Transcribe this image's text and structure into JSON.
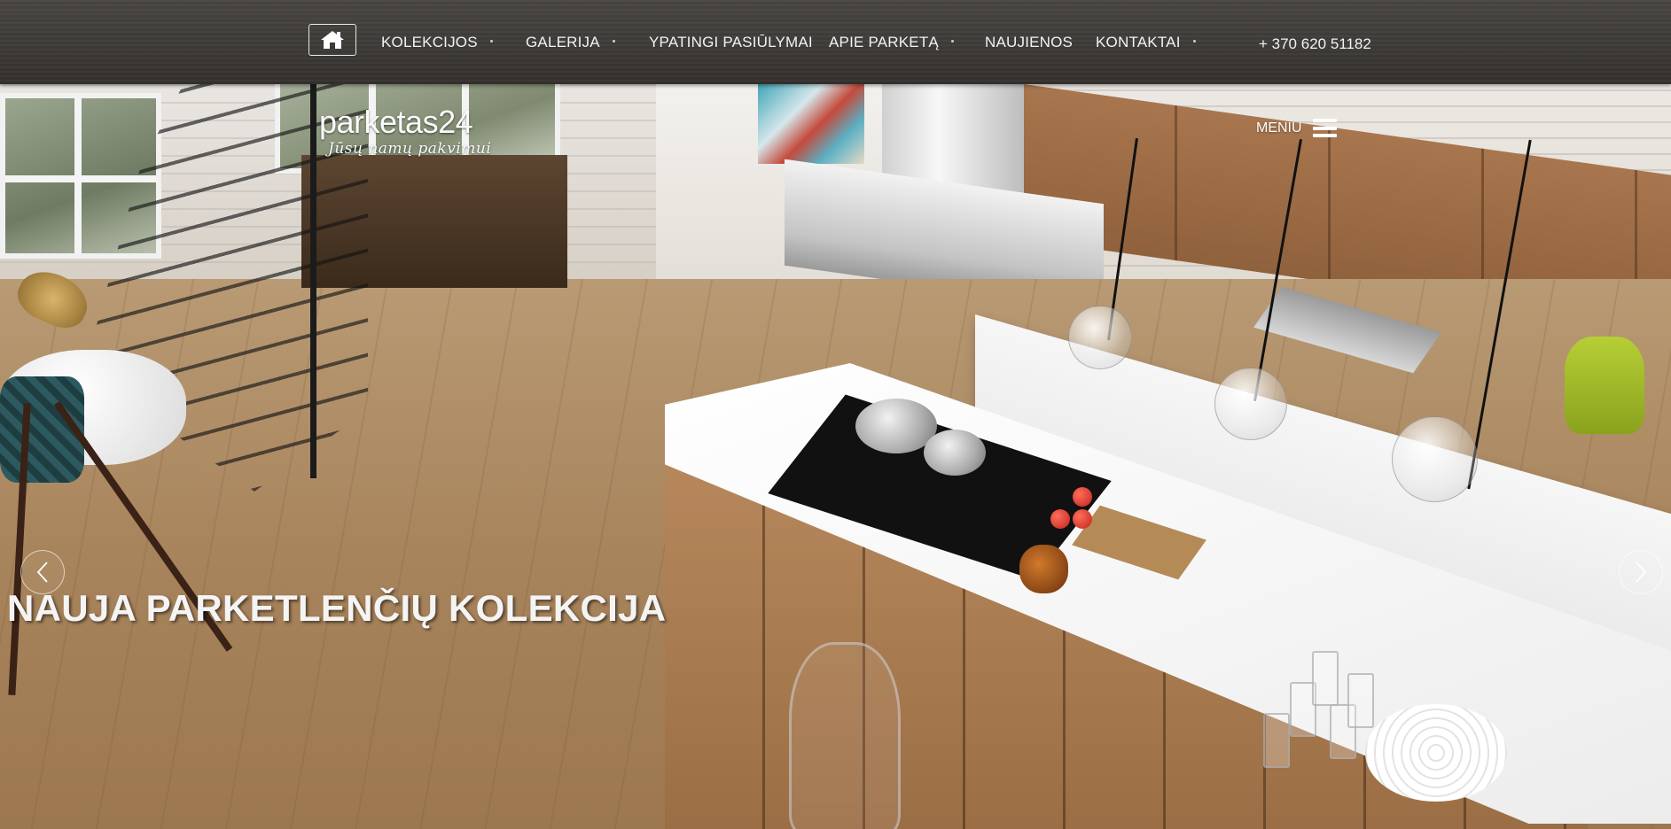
{
  "nav": {
    "home_icon": "home-icon",
    "items": [
      {
        "label": "KOLEKCIJOS",
        "has_dropdown": true
      },
      {
        "label": "GALERIJA",
        "has_dropdown": true
      },
      {
        "label": "YPATINGI PASIŪLYMAI",
        "has_dropdown": false
      },
      {
        "label": "APIE PARKETĄ",
        "has_dropdown": true
      },
      {
        "label": "NAUJIENOS",
        "has_dropdown": false
      },
      {
        "label": "KONTAKTAI",
        "has_dropdown": true
      }
    ],
    "phone": "+ 370 620 51182"
  },
  "logo": {
    "name": "parketas24",
    "tagline": "Jūsų namų pakvimui"
  },
  "menu_toggle": {
    "label": "MENIU",
    "icon": "hamburger-icon"
  },
  "slider": {
    "title": "NAUJA PARKETLENČIŲ KOLEKCIJA",
    "prev_icon": "chevron-left-icon",
    "next_icon": "chevron-right-icon"
  },
  "colors": {
    "nav_bg": "#3f3c39",
    "nav_text": "#f2f2f2",
    "title_text": "#f4f4f4"
  }
}
